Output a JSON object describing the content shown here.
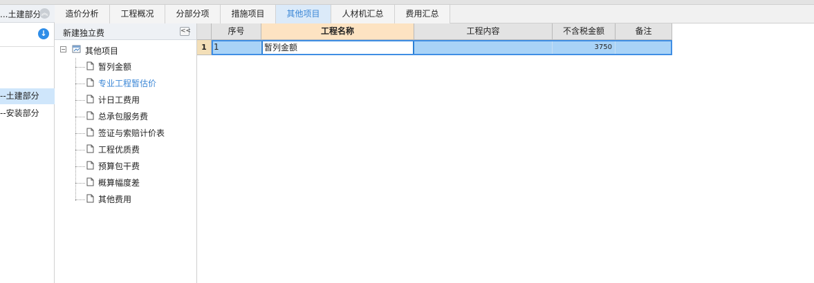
{
  "left_panel": {
    "title": "...土建部分",
    "items": [
      {
        "label": "--土建部分",
        "selected": true
      },
      {
        "label": "--安装部分",
        "selected": false
      }
    ]
  },
  "tabs": [
    {
      "label": "造价分析",
      "active": false
    },
    {
      "label": "工程概况",
      "active": false
    },
    {
      "label": "分部分项",
      "active": false
    },
    {
      "label": "措施项目",
      "active": false
    },
    {
      "label": "其他项目",
      "active": true
    },
    {
      "label": "人材机汇总",
      "active": false
    },
    {
      "label": "费用汇总",
      "active": false
    }
  ],
  "tree_panel": {
    "title": "新建独立费",
    "collapse_label": "<<",
    "root": "其他项目",
    "items": [
      {
        "label": "暂列金额",
        "highlighted": false
      },
      {
        "label": "专业工程暂估价",
        "highlighted": true
      },
      {
        "label": "计日工费用",
        "highlighted": false
      },
      {
        "label": "总承包服务费",
        "highlighted": false
      },
      {
        "label": "签证与索赔计价表",
        "highlighted": false
      },
      {
        "label": "工程优质费",
        "highlighted": false
      },
      {
        "label": "预算包干费",
        "highlighted": false
      },
      {
        "label": "概算幅度差",
        "highlighted": false
      },
      {
        "label": "其他费用",
        "highlighted": false
      }
    ]
  },
  "grid": {
    "columns": [
      "序号",
      "工程名称",
      "工程内容",
      "不含税金额",
      "备注"
    ],
    "active_column": 1,
    "rows": [
      {
        "row_number": "1",
        "cells": [
          "1",
          "暂列金额",
          "",
          "3750",
          ""
        ]
      }
    ]
  },
  "colors": {
    "accent": "#3a86d6",
    "selection": "#a9d3f7",
    "active_header": "#fde3c2"
  }
}
